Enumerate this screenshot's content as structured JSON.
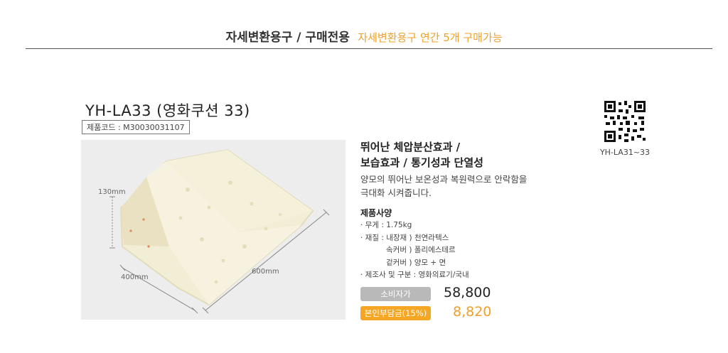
{
  "header": {
    "category": "자세변환용구 / 구매전용",
    "note": "자세변환용구 연간 5개 구매가능"
  },
  "product": {
    "title": "YH-LA33 (영화쿠션 33)",
    "code": "제품코드 : M30030031107"
  },
  "image": {
    "label_height": "130mm",
    "label_width": "400mm",
    "label_length": "600mm"
  },
  "qr": {
    "caption": "YH-LA31~33"
  },
  "features": {
    "headline_1": "뛰어난 체압분산효과 /",
    "headline_2": "보습효과 / 통기성과 단열성",
    "desc_1": "양모의 뛰어난 보온성과 복원력으로 안락함을",
    "desc_2": "극대화 시켜줍니다."
  },
  "specs": {
    "title": "제품사양",
    "items": [
      "· 무게 : 1.75kg",
      "· 재질 : 내장재 ) 천연라텍스",
      "속커버 ) 폴리에스테르",
      "겉커버 ) 양모 + 면",
      "· 제조사 및 구분 : 영화의료기/국내"
    ]
  },
  "pricing": {
    "consumer_label": "소비자가",
    "consumer_price": "58,800",
    "copay_label": "본인부담금(15%)",
    "copay_price": "8,820",
    "accent_color": "#f5a623"
  }
}
